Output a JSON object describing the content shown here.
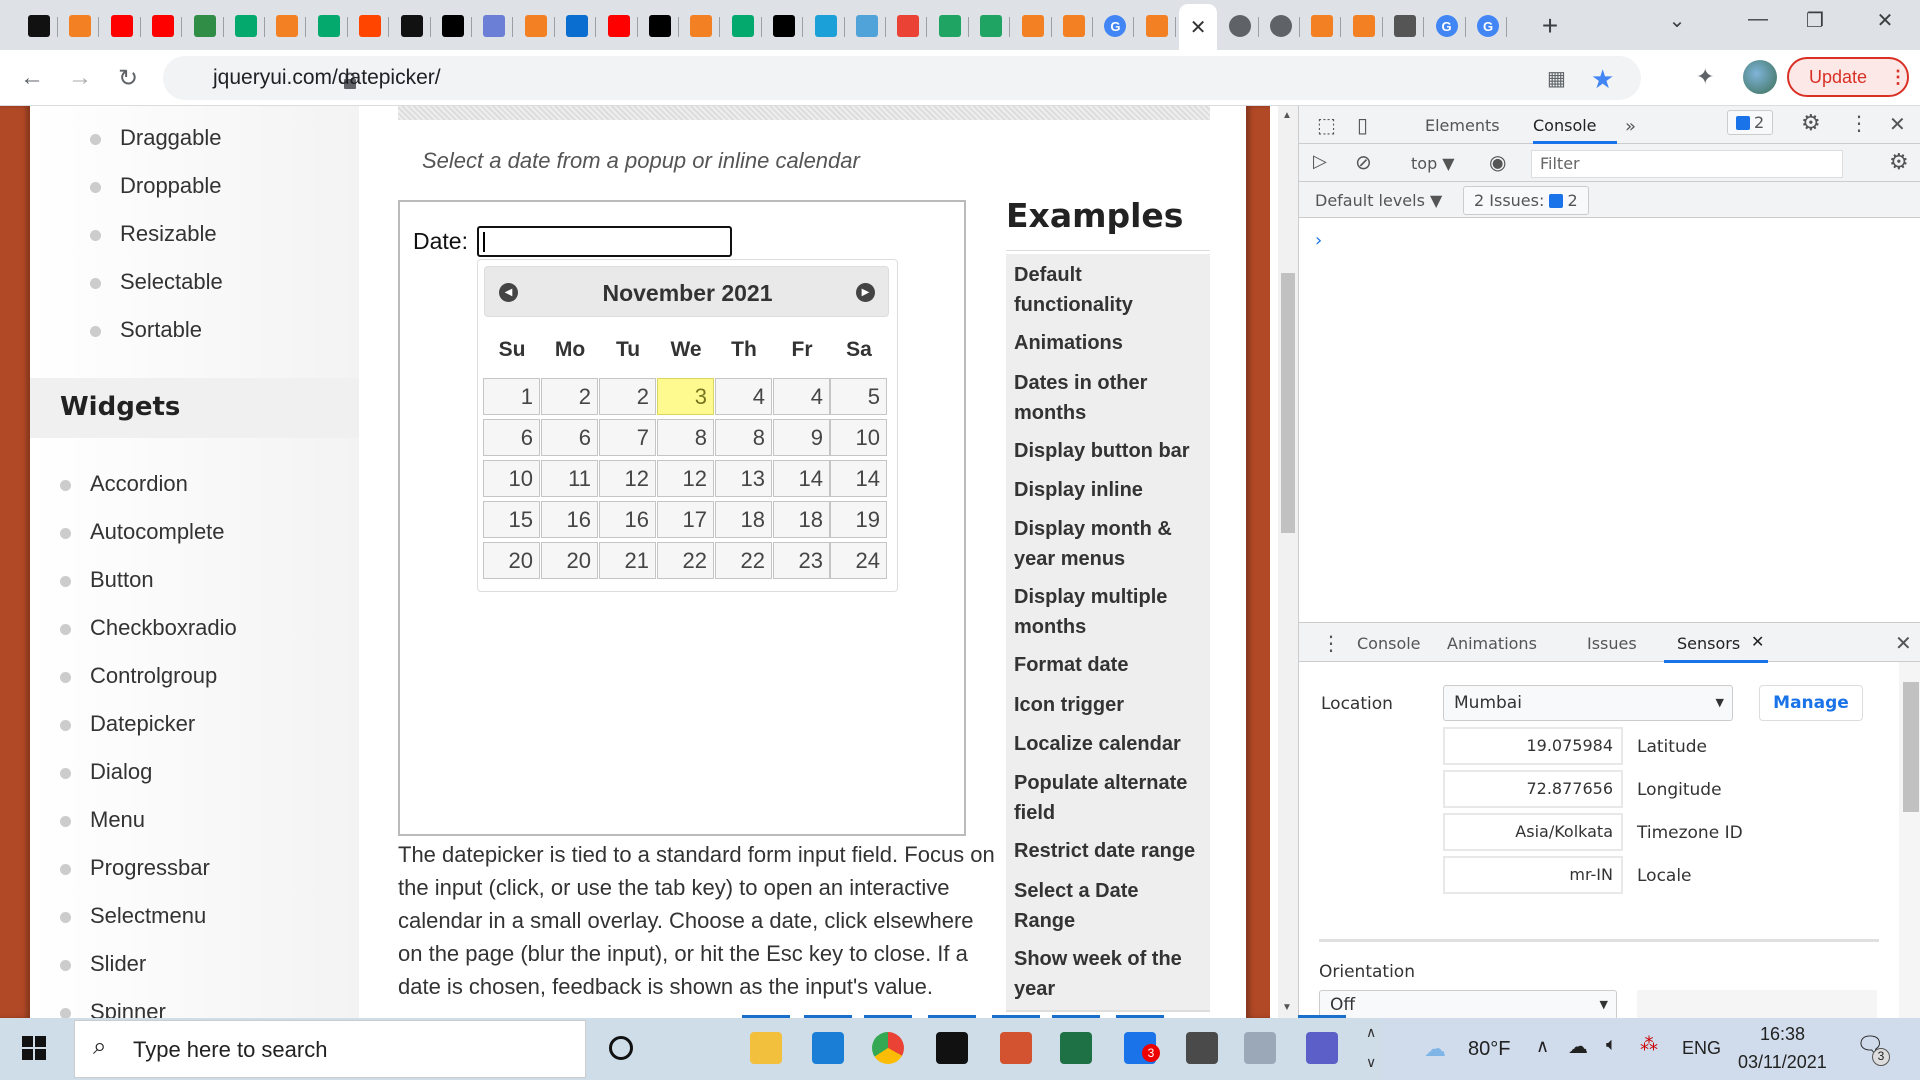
{
  "browser": {
    "tabs": [
      {
        "icon": "jquery-icon"
      },
      {
        "icon": "stackoverflow-icon"
      },
      {
        "icon": "youtube-icon"
      },
      {
        "icon": "youtube-icon"
      },
      {
        "icon": "geeksforgeeks-icon"
      },
      {
        "icon": "w3schools-icon"
      },
      {
        "icon": "stackoverflow-icon"
      },
      {
        "icon": "w3schools-icon"
      },
      {
        "icon": "reddit-icon"
      },
      {
        "icon": "github-icon"
      },
      {
        "icon": "app-icon"
      },
      {
        "icon": "mdb-icon"
      },
      {
        "icon": "stackoverflow-icon"
      },
      {
        "icon": "onedrive-icon"
      },
      {
        "icon": "youtube-icon"
      },
      {
        "icon": "app-icon"
      },
      {
        "icon": "stackoverflow-icon"
      },
      {
        "icon": "w3schools-icon"
      },
      {
        "icon": "app-icon"
      },
      {
        "icon": "s-icon"
      },
      {
        "icon": "message-icon"
      },
      {
        "icon": "gmail-icon"
      },
      {
        "icon": "drive-icon"
      },
      {
        "icon": "drive-icon"
      },
      {
        "icon": "stackoverflow-icon"
      },
      {
        "icon": "stackoverflow-icon"
      },
      {
        "icon": "google-icon"
      },
      {
        "icon": "stackoverflow-icon"
      },
      {
        "icon": "active-tab-close",
        "active": true
      },
      {
        "icon": "globe-icon"
      },
      {
        "icon": "globe-icon"
      },
      {
        "icon": "stackoverflow-icon"
      },
      {
        "icon": "stackoverflow-icon"
      },
      {
        "icon": "chrome-icon"
      },
      {
        "icon": "google-icon"
      },
      {
        "icon": "google-icon"
      }
    ],
    "new_tab": "+",
    "url": "jqueryui.com/datepicker/",
    "update_label": "Update"
  },
  "sidebar": {
    "interactions": [
      "Draggable",
      "Droppable",
      "Resizable",
      "Selectable",
      "Sortable"
    ],
    "widgets_heading": "Widgets",
    "widgets": [
      "Accordion",
      "Autocomplete",
      "Button",
      "Checkboxradio",
      "Controlgroup",
      "Datepicker",
      "Dialog",
      "Menu",
      "Progressbar",
      "Selectmenu",
      "Slider",
      "Spinner"
    ]
  },
  "main": {
    "subtitle": "Select a date from a popup or inline calendar",
    "date_label": "Date:",
    "date_value": "",
    "calendar": {
      "title": "November 2021",
      "prev_label": "Prev",
      "next_label": "Next",
      "weekdays": [
        "Su",
        "Mo",
        "Tu",
        "We",
        "Th",
        "Fr",
        "Sa"
      ],
      "weeks": [
        [
          "1",
          "2",
          "2",
          "3",
          "4",
          "4",
          "5"
        ],
        [
          "6",
          "6",
          "7",
          "8",
          "8",
          "9",
          "10"
        ],
        [
          "10",
          "11",
          "12",
          "12",
          "13",
          "14",
          "14"
        ],
        [
          "15",
          "16",
          "16",
          "17",
          "18",
          "18",
          "19"
        ],
        [
          "20",
          "20",
          "21",
          "22",
          "22",
          "23",
          "24"
        ]
      ],
      "highlighted": "3"
    },
    "description": "The datepicker is tied to a standard form input field. Focus on the input (click, or use the tab key) to open an interactive calendar in a small overlay. Choose a date, click elsewhere on the page (blur the input), or hit the Esc key to close. If a date is chosen, feedback is shown as the input's value."
  },
  "examples": {
    "heading": "Examples",
    "items": [
      "Default functionality",
      "Animations",
      "Dates in other months",
      "Display button bar",
      "Display inline",
      "Display month & year menus",
      "Display multiple months",
      "Format date",
      "Icon trigger",
      "Localize calendar",
      "Populate alternate field",
      "Restrict date range",
      "Select a Date Range",
      "Show week of the year"
    ]
  },
  "devtools": {
    "tabs": [
      "Elements",
      "Console"
    ],
    "active_tab": "Console",
    "more": "»",
    "issues_badge": "2",
    "context": "top ▼",
    "filter_placeholder": "Filter",
    "levels": "Default levels ▼",
    "issues_label": "2 Issues:",
    "issues_count": "2",
    "prompt": "›",
    "drawer_tabs": [
      "Console",
      "Animations",
      "Issues",
      "Sensors"
    ],
    "drawer_active": "Sensors",
    "sensors": {
      "location_label": "Location",
      "location_value": "Mumbai",
      "manage_label": "Manage",
      "fields": [
        {
          "value": "19.075984",
          "label": "Latitude"
        },
        {
          "value": "72.877656",
          "label": "Longitude"
        },
        {
          "value": "Asia/Kolkata",
          "label": "Timezone ID"
        },
        {
          "value": "mr-IN",
          "label": "Locale"
        }
      ],
      "orientation_label": "Orientation",
      "orientation_value": "Off"
    }
  },
  "taskbar": {
    "search_placeholder": "Type here to search",
    "apps": [
      "cortana-icon",
      "task-view-icon",
      "file-explorer-icon",
      "mail-icon",
      "chrome-icon",
      "terminal-icon",
      "powerpoint-icon",
      "excel-icon",
      "zalo-icon",
      "sublime-icon",
      "monitor-icon",
      "teams-icon"
    ],
    "zalo_badge": "3",
    "weather": "80°F",
    "language": "ENG",
    "time": "16:38",
    "date": "03/11/2021",
    "notifications": "3",
    "colors": {
      "accent": "#1a73e8",
      "jquery_orange": "#b24926",
      "today": "#fffa90"
    }
  }
}
